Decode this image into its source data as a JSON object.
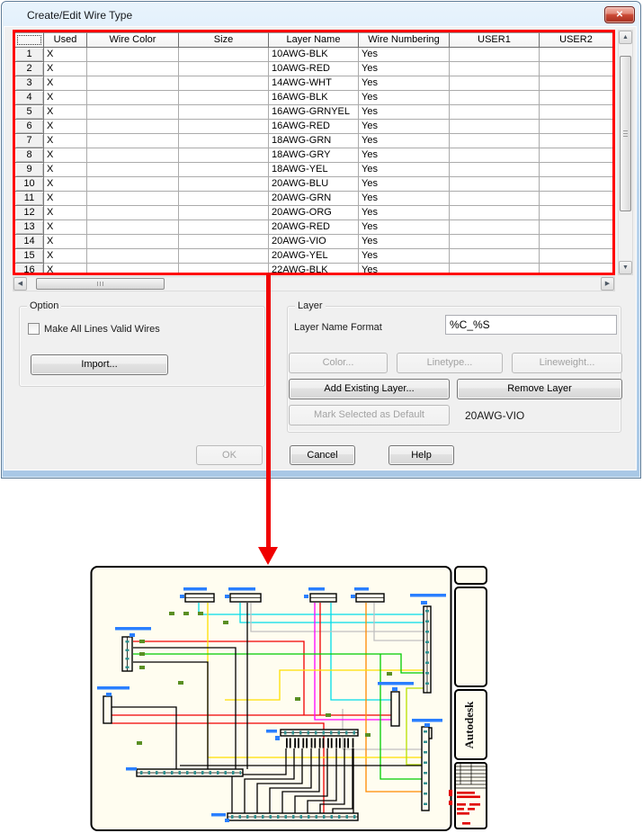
{
  "window": {
    "title": "Create/Edit Wire Type",
    "close_glyph": "✕"
  },
  "table": {
    "columns": [
      "",
      "Used",
      "Wire Color",
      "Size",
      "Layer Name",
      "Wire Numbering",
      "USER1",
      "USER2"
    ],
    "rows": [
      {
        "num": "1",
        "used": "X",
        "wire_color": "",
        "size": "",
        "layer_name": "10AWG-BLK",
        "wire_numbering": "Yes",
        "user1": "",
        "user2": ""
      },
      {
        "num": "2",
        "used": "X",
        "wire_color": "",
        "size": "",
        "layer_name": "10AWG-RED",
        "wire_numbering": "Yes",
        "user1": "",
        "user2": ""
      },
      {
        "num": "3",
        "used": "X",
        "wire_color": "",
        "size": "",
        "layer_name": "14AWG-WHT",
        "wire_numbering": "Yes",
        "user1": "",
        "user2": ""
      },
      {
        "num": "4",
        "used": "X",
        "wire_color": "",
        "size": "",
        "layer_name": "16AWG-BLK",
        "wire_numbering": "Yes",
        "user1": "",
        "user2": ""
      },
      {
        "num": "5",
        "used": "X",
        "wire_color": "",
        "size": "",
        "layer_name": "16AWG-GRNYEL",
        "wire_numbering": "Yes",
        "user1": "",
        "user2": ""
      },
      {
        "num": "6",
        "used": "X",
        "wire_color": "",
        "size": "",
        "layer_name": "16AWG-RED",
        "wire_numbering": "Yes",
        "user1": "",
        "user2": ""
      },
      {
        "num": "7",
        "used": "X",
        "wire_color": "",
        "size": "",
        "layer_name": "18AWG-GRN",
        "wire_numbering": "Yes",
        "user1": "",
        "user2": ""
      },
      {
        "num": "8",
        "used": "X",
        "wire_color": "",
        "size": "",
        "layer_name": "18AWG-GRY",
        "wire_numbering": "Yes",
        "user1": "",
        "user2": ""
      },
      {
        "num": "9",
        "used": "X",
        "wire_color": "",
        "size": "",
        "layer_name": "18AWG-YEL",
        "wire_numbering": "Yes",
        "user1": "",
        "user2": ""
      },
      {
        "num": "10",
        "used": "X",
        "wire_color": "",
        "size": "",
        "layer_name": "20AWG-BLU",
        "wire_numbering": "Yes",
        "user1": "",
        "user2": ""
      },
      {
        "num": "11",
        "used": "X",
        "wire_color": "",
        "size": "",
        "layer_name": "20AWG-GRN",
        "wire_numbering": "Yes",
        "user1": "",
        "user2": ""
      },
      {
        "num": "12",
        "used": "X",
        "wire_color": "",
        "size": "",
        "layer_name": "20AWG-ORG",
        "wire_numbering": "Yes",
        "user1": "",
        "user2": ""
      },
      {
        "num": "13",
        "used": "X",
        "wire_color": "",
        "size": "",
        "layer_name": "20AWG-RED",
        "wire_numbering": "Yes",
        "user1": "",
        "user2": ""
      },
      {
        "num": "14",
        "used": "X",
        "wire_color": "",
        "size": "",
        "layer_name": "20AWG-VIO",
        "wire_numbering": "Yes",
        "user1": "",
        "user2": ""
      },
      {
        "num": "15",
        "used": "X",
        "wire_color": "",
        "size": "",
        "layer_name": "20AWG-YEL",
        "wire_numbering": "Yes",
        "user1": "",
        "user2": ""
      },
      {
        "num": "16",
        "used": "X",
        "wire_color": "",
        "size": "",
        "layer_name": "22AWG-BLK",
        "wire_numbering": "Yes",
        "user1": "",
        "user2": "",
        "partial": true
      }
    ]
  },
  "option_group": {
    "label": "Option",
    "checkbox_label": "Make All Lines Valid Wires",
    "checkbox_checked": false,
    "import_label": "Import..."
  },
  "layer_group": {
    "label": "Layer",
    "format_label": "Layer Name Format",
    "format_value": "%C_%S",
    "color_label": "Color...",
    "linetype_label": "Linetype...",
    "lineweight_label": "Lineweight...",
    "add_existing_label": "Add Existing Layer...",
    "remove_label": "Remove Layer",
    "mark_default_label": "Mark Selected as Default",
    "default_wire_type": "20AWG-VIO"
  },
  "footer": {
    "ok_label": "OK",
    "cancel_label": "Cancel",
    "help_label": "Help"
  },
  "annotation": {
    "highlight_color": "#ff0000",
    "meaning": "red box around wire-type grid with arrow pointing to drawing"
  },
  "drawing": {
    "brand": "Autodesk",
    "sheet_background": "#fffdf0",
    "wire_colors": {
      "cyan": "#00dce8",
      "gray": "#c0c0c0",
      "red": "#f00000",
      "yellow": "#ffe000",
      "green": "#00cc00",
      "magenta": "#ff00ff",
      "orange": "#ff8a00",
      "chartreuse": "#b8e000",
      "black": "#000000"
    }
  }
}
